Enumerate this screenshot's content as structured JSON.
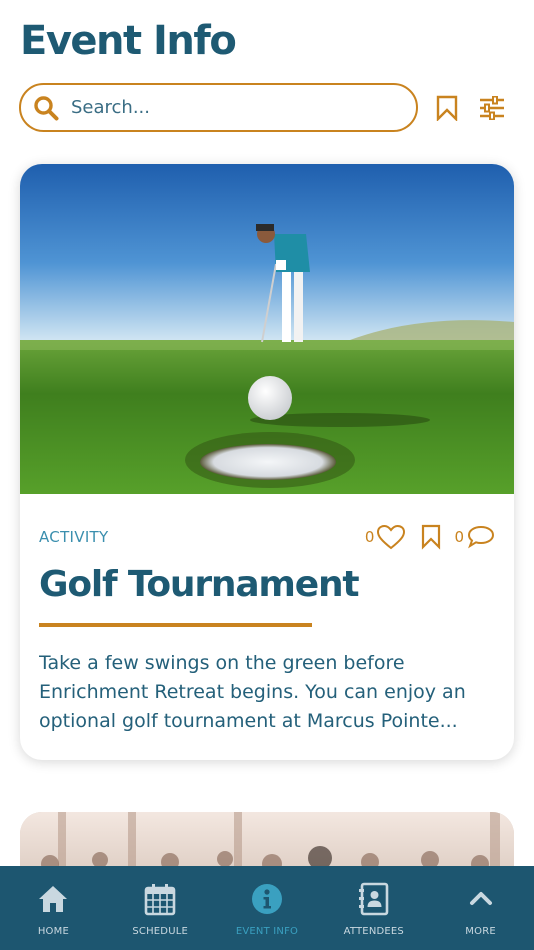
{
  "header": {
    "title": "Event Info"
  },
  "search": {
    "placeholder": "Search..."
  },
  "event_card": {
    "category": "ACTIVITY",
    "likes": "0",
    "comments": "0",
    "title": "Golf Tournament",
    "description_lines": [
      "Take a few swings on the green before",
      "Enrichment Retreat begins. You can enjoy an",
      "optional golf tournament at Marcus Pointe..."
    ]
  },
  "tab_bar": {
    "tabs": [
      {
        "label": "HOME",
        "icon": "home-icon"
      },
      {
        "label": "SCHEDULE",
        "icon": "calendar-icon"
      },
      {
        "label": "EVENT INFO",
        "icon": "info-icon",
        "active": true
      },
      {
        "label": "ATTENDEES",
        "icon": "contact-card-icon"
      },
      {
        "label": "MORE",
        "icon": "chevron-up-icon"
      }
    ]
  },
  "colors": {
    "primary": "#1e5a73",
    "accent": "#c9831f",
    "category": "#3b8fae",
    "tab_bar": "#1d5670",
    "tab_active": "#3aa0c0"
  }
}
